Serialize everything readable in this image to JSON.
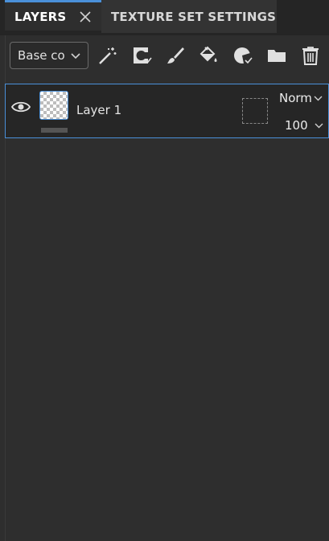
{
  "tabs": {
    "layers": "LAYERS",
    "texture_set_settings": "TEXTURE SET SETTINGS"
  },
  "toolbar": {
    "channel_dropdown": "Base co",
    "icons": [
      "magic-wand-icon",
      "add-fill-layer-icon",
      "paint-brush-icon",
      "fill-bucket-icon",
      "add-mask-icon",
      "folder-icon",
      "trash-icon"
    ]
  },
  "layers": [
    {
      "name": "Layer 1",
      "blend_mode": "Norm",
      "opacity": "100",
      "visible": true
    }
  ],
  "colors": {
    "accent": "#4a90d9",
    "panel_bg": "#2e2e2e",
    "row_bg": "#262626"
  }
}
